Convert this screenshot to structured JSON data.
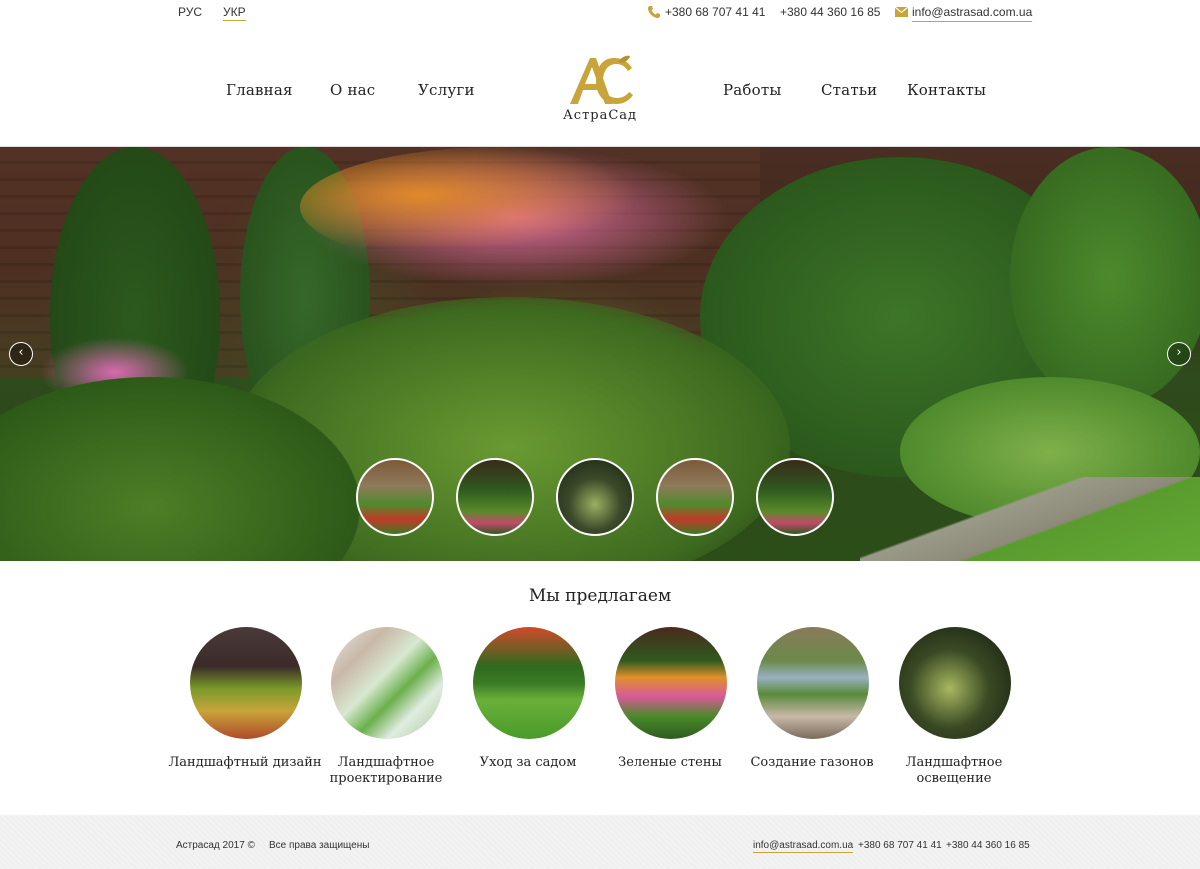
{
  "topbar": {
    "lang_ru": "РУС",
    "lang_uk": "УКР",
    "phone1": "+380 68 707 41 41",
    "phone2": "+380 44 360 16 85",
    "email": "info@astrasad.com.ua"
  },
  "nav": {
    "home": "Главная",
    "about": "О нас",
    "services": "Услуги",
    "works": "Работы",
    "articles": "Статьи",
    "contacts": "Контакты"
  },
  "logo": {
    "text": "АстраСад"
  },
  "slider": {
    "prev_icon": "chevron-left-icon",
    "next_icon": "chevron-right-icon",
    "thumbnails": 5
  },
  "offers": {
    "title": "Мы предлагаем",
    "items": [
      {
        "label": "Ландшафтный дизайн"
      },
      {
        "label": "Ландшафтное проектирование"
      },
      {
        "label": "Уход за садом"
      },
      {
        "label": "Зеленые стены"
      },
      {
        "label": "Создание газонов"
      },
      {
        "label": "Ландшафтное освещение"
      }
    ]
  },
  "footer": {
    "copyright": "Астрасад 2017 ©",
    "rights": "Все права защищены",
    "email": "info@astrasad.com.ua",
    "phone1": "+380 68 707 41 41",
    "phone2": "+380 44 360 16 85"
  },
  "colors": {
    "accent": "#c9a43b",
    "text": "#222222"
  }
}
